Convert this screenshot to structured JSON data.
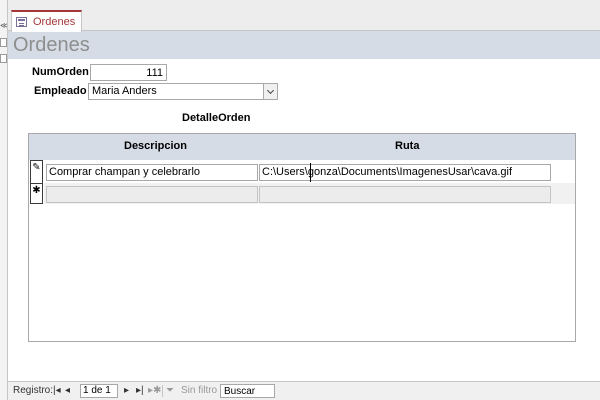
{
  "tab": {
    "label": "Ordenes",
    "icon": "form-icon"
  },
  "form": {
    "title": "Ordenes",
    "fields": {
      "numorden": {
        "label": "NumOrden",
        "value": "111"
      },
      "empleado": {
        "label": "Empleado",
        "value": "Maria Anders"
      }
    }
  },
  "subform": {
    "label": "DetalleOrden",
    "columns": {
      "descripcion": "Descripcion",
      "ruta": "Ruta"
    },
    "rows": [
      {
        "selector": "✎",
        "descripcion": "Comprar champan y celebrarlo",
        "ruta": "C:\\Users\\gonza\\Documents\\ImagenesUsar\\cava.gif"
      },
      {
        "selector": "✱",
        "descripcion": "",
        "ruta": ""
      }
    ]
  },
  "record_nav": {
    "label": "Registro:",
    "position": "1 de 1",
    "filter_label": "Sin filtro",
    "search_placeholder": "Buscar"
  },
  "colors": {
    "header_band": "#d6dce5",
    "tab_accent": "#a4373a"
  }
}
